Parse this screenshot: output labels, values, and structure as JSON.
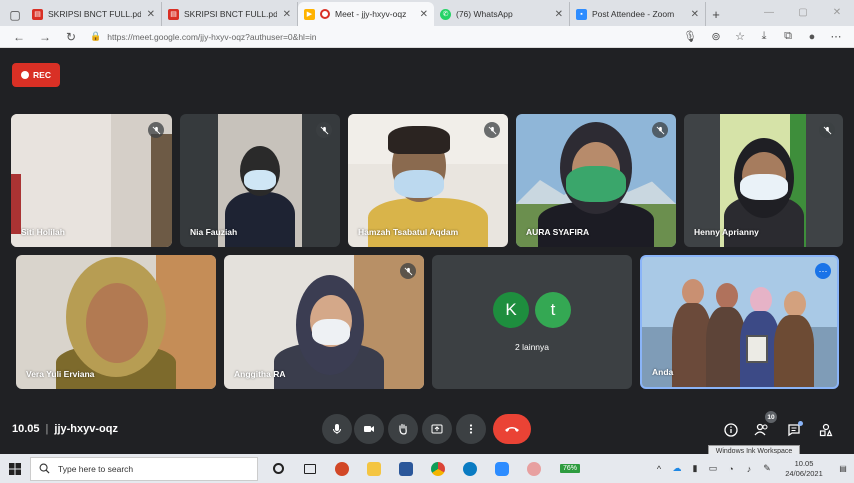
{
  "browser": {
    "tabs": [
      {
        "title": "SKRIPSI BNCT FULL.pdf",
        "icon_color": "#d93025",
        "active": false
      },
      {
        "title": "SKRIPSI BNCT FULL.pdf",
        "icon_color": "#d93025",
        "active": false
      },
      {
        "title": "Meet - jjy-hxyv-oqz",
        "icon_color": "#d93025",
        "active": true
      },
      {
        "title": "(76) WhatsApp",
        "icon_color": "#25d366",
        "active": false
      },
      {
        "title": "Post Attendee - Zoom",
        "icon_color": "#2d8cff",
        "active": false
      }
    ],
    "url": "https://meet.google.com/jjy-hxyv-oqz?authuser=0&hl=in"
  },
  "meet": {
    "rec_label": "REC",
    "participants": [
      {
        "name": "Siti Holilah",
        "muted": true
      },
      {
        "name": "Nia Fauziah",
        "muted": true
      },
      {
        "name": "Hamzah Tsabatul Aqdam",
        "muted": true
      },
      {
        "name": "AURA SYAFIRA",
        "muted": true
      },
      {
        "name": "Henny Aprianny",
        "muted": true
      },
      {
        "name": "Vera Yuli Erviana",
        "muted": false
      },
      {
        "name": "Anggitha RA",
        "muted": true
      },
      {
        "name": "Anda",
        "muted": false
      }
    ],
    "others": {
      "avatars": [
        {
          "letter": "K",
          "color": "#1e8e3e"
        },
        {
          "letter": "t",
          "color": "#34a853"
        }
      ],
      "label": "2 lainnya"
    },
    "time": "10.05",
    "meeting_code": "jjy-hxyv-oqz",
    "participant_count": "10",
    "tooltip": "Windows Ink Workspace"
  },
  "taskbar": {
    "search_placeholder": "Type here to search",
    "battery": "76%",
    "clock_time": "10.05",
    "clock_date": "24/06/2021"
  }
}
